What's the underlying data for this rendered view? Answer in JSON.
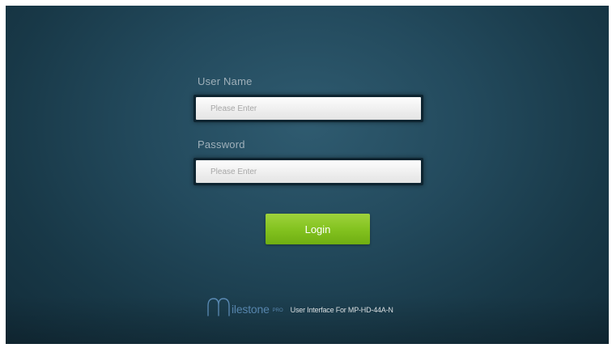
{
  "login_form": {
    "username_label": "User Name",
    "username_placeholder": "Please Enter",
    "username_value": "",
    "password_label": "Password",
    "password_placeholder": "Please Enter",
    "password_value": "",
    "login_button_label": "Login"
  },
  "footer": {
    "brand_name": "ilestone",
    "brand_suffix": "PRO",
    "caption": "User Interface For MP-HD-44A-N",
    "logo_icon": "milestone-m-logo-icon"
  },
  "colors": {
    "background": "#234a5d",
    "login_button": "#84c320",
    "brand": "#5b8cb6"
  }
}
